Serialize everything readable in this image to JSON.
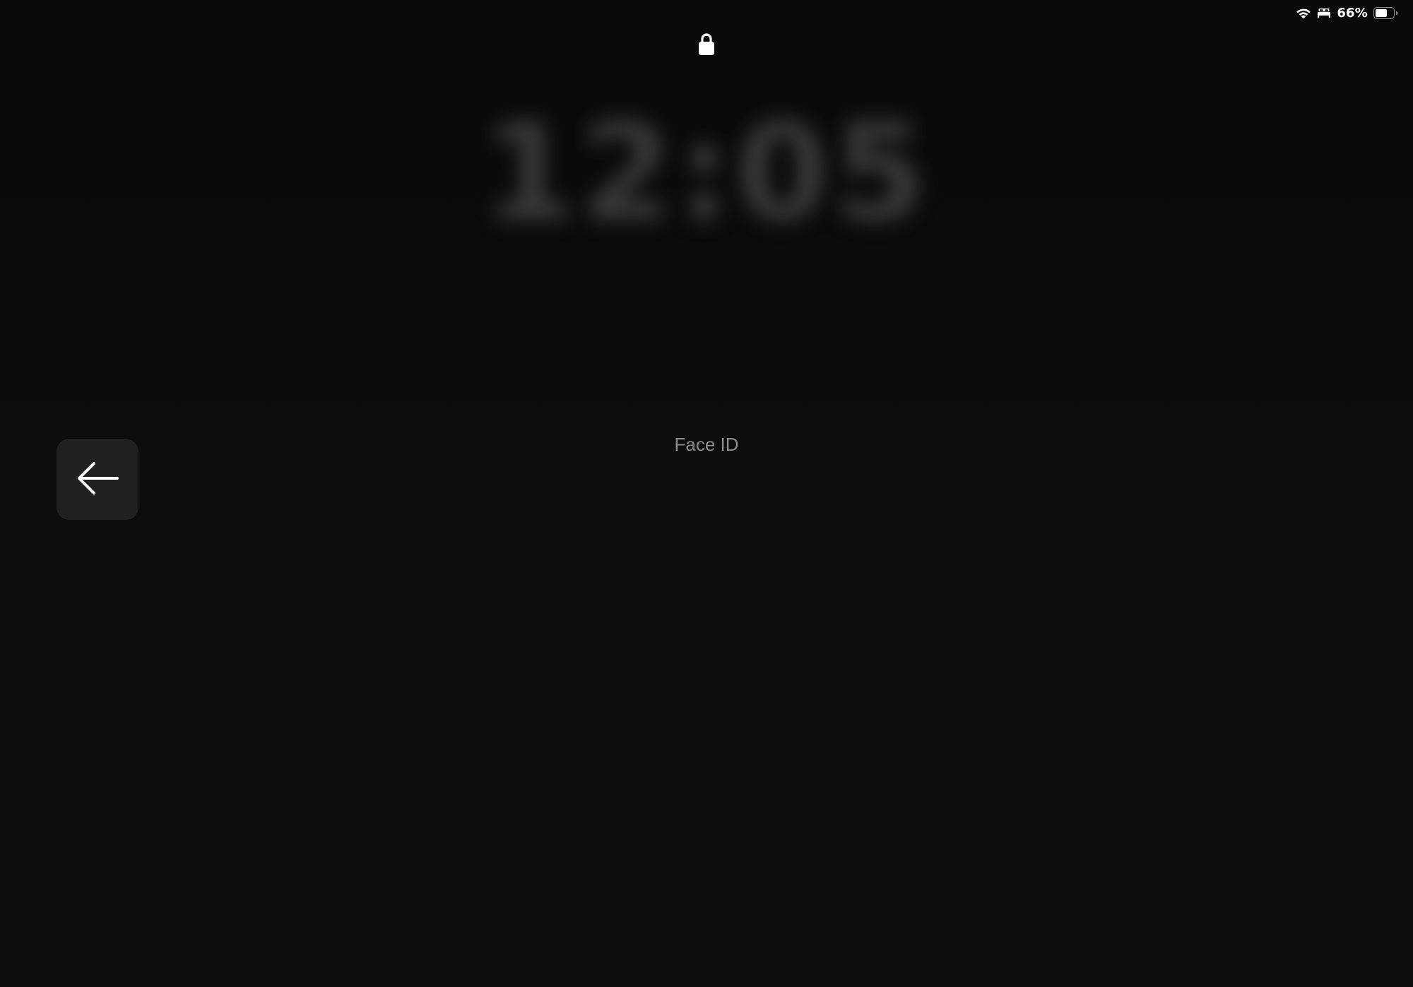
{
  "status_bar": {
    "battery_percent_text": "66%",
    "battery_level": 0.66,
    "icons": [
      "wifi-icon",
      "bed-icon",
      "battery-icon"
    ]
  },
  "lock_screen": {
    "lock_icon": "lock-icon",
    "clock_text": "12:05",
    "auth_label": "Face ID"
  },
  "controls": {
    "back_icon": "arrow-left-icon"
  },
  "colors": {
    "background": "#0a0b0b",
    "label_gray": "#8b8b8b",
    "button_bg": "#1f2020"
  }
}
